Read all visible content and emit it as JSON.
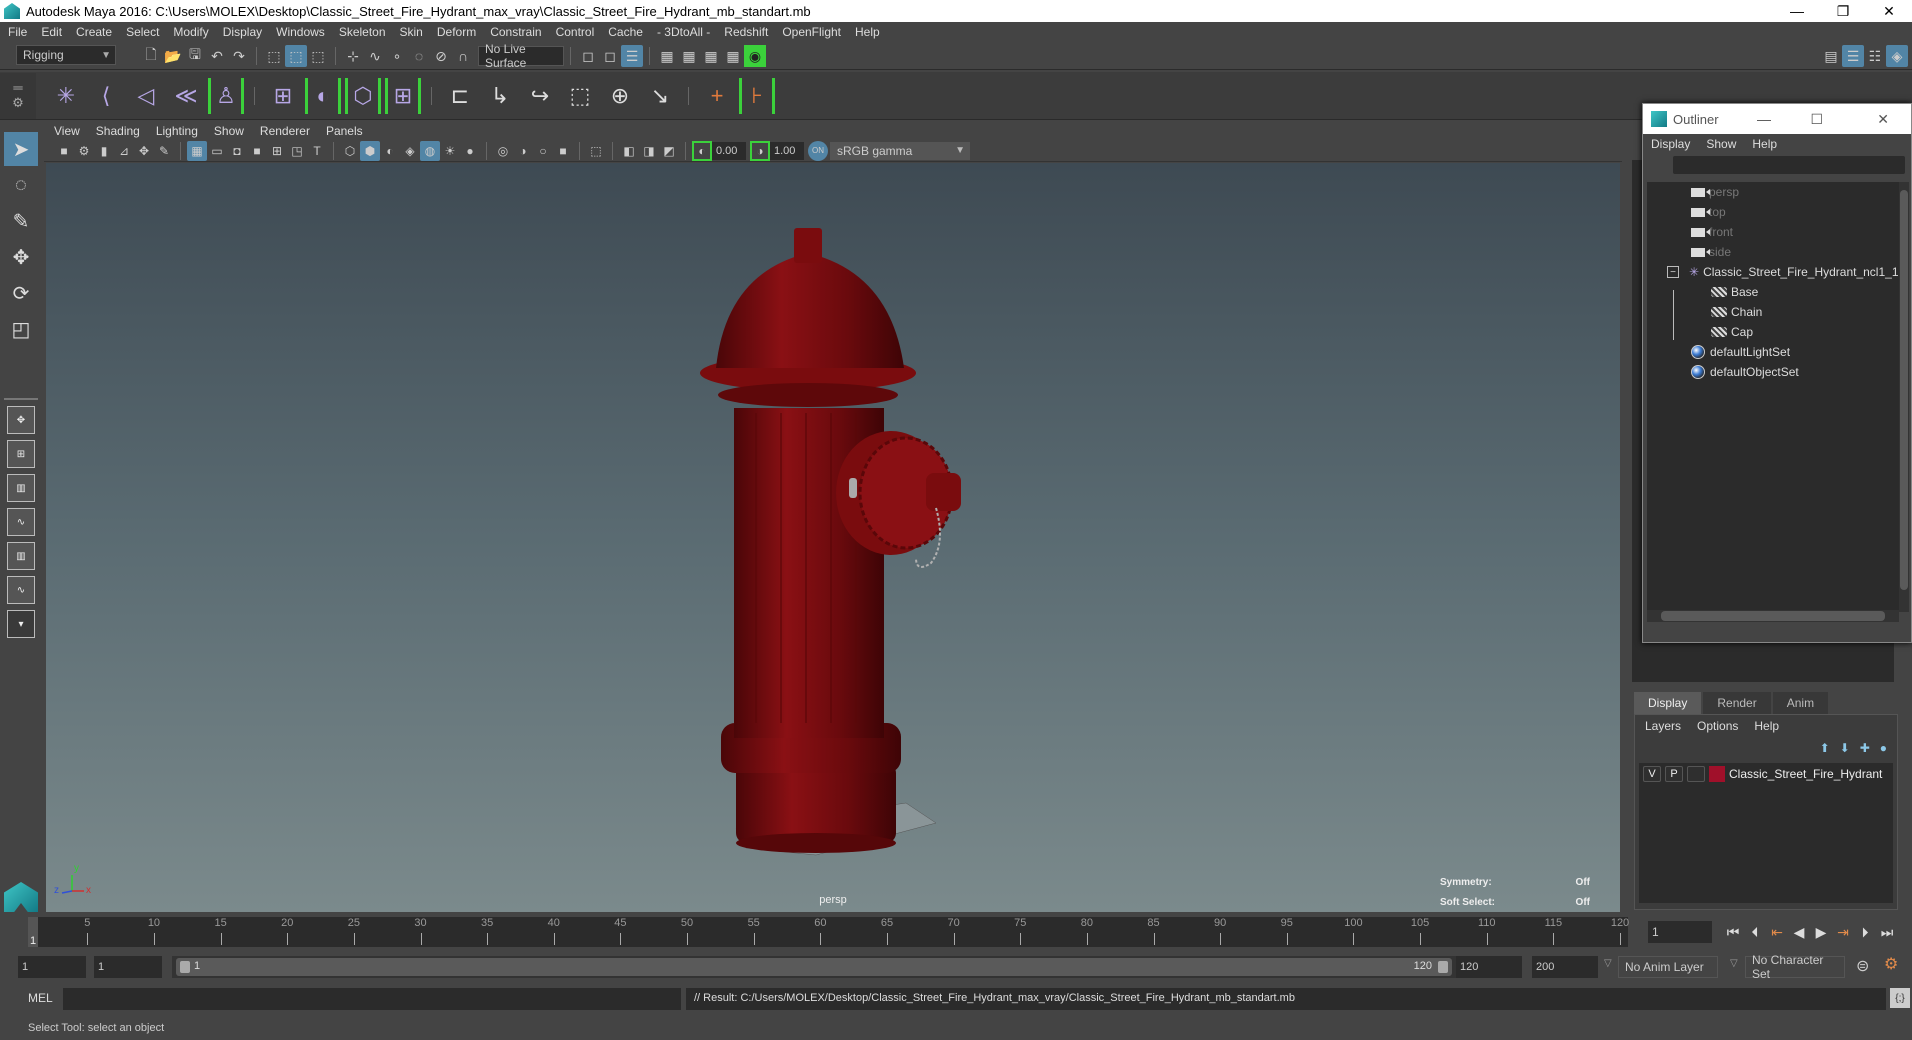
{
  "window": {
    "title": "Autodesk Maya 2016: C:\\Users\\MOLEX\\Desktop\\Classic_Street_Fire_Hydrant_max_vray\\Classic_Street_Fire_Hydrant_mb_standart.mb",
    "controls": {
      "minimize": "—",
      "restore": "❐",
      "close": "✕"
    }
  },
  "menubar": [
    "File",
    "Edit",
    "Create",
    "Select",
    "Modify",
    "Display",
    "Windows",
    "Skeleton",
    "Skin",
    "Deform",
    "Constrain",
    "Control",
    "Cache",
    "- 3DtoAll -",
    "Redshift",
    "OpenFlight",
    "Help"
  ],
  "statusline": {
    "menuset": "Rigging",
    "live_surface": "No Live Surface"
  },
  "shelf": {
    "tools": [
      "joint-tool",
      "ik-handle",
      "ik-spline",
      "skin-bind",
      "humanik",
      "paint-weights",
      "smooth-bind",
      "lattice",
      "cluster",
      "parent-constraint",
      "point-constraint",
      "orient-constraint",
      "scale-constraint",
      "aim-constraint",
      "pole-vector",
      "locator-orange",
      "locator-bracket-orange"
    ]
  },
  "viewport": {
    "menu": [
      "View",
      "Shading",
      "Lighting",
      "Show",
      "Renderer",
      "Panels"
    ],
    "exposure": "0.00",
    "gamma": "1.00",
    "colorspace": "sRGB gamma",
    "camera_label": "persp",
    "hud": [
      {
        "label": "Symmetry:",
        "value": "Off"
      },
      {
        "label": "Soft Select:",
        "value": "Off"
      }
    ],
    "axis": {
      "x": "x",
      "y": "y",
      "z": "z"
    },
    "object_color": "#7a0c0e"
  },
  "outliner": {
    "title": "Outliner",
    "menu": [
      "Display",
      "Show",
      "Help"
    ],
    "search_value": "",
    "items": [
      {
        "label": "persp",
        "icon": "camera-icon",
        "level": 1,
        "dim": true
      },
      {
        "label": "top",
        "icon": "camera-icon",
        "level": 1,
        "dim": true
      },
      {
        "label": "front",
        "icon": "camera-icon",
        "level": 1,
        "dim": true
      },
      {
        "label": "side",
        "icon": "camera-icon",
        "level": 1,
        "dim": true
      },
      {
        "label": "Classic_Street_Fire_Hydrant_ncl1_1",
        "icon": "group-icon",
        "level": 1,
        "expanded": true
      },
      {
        "label": "Base",
        "icon": "mesh-icon",
        "level": 2
      },
      {
        "label": "Chain",
        "icon": "mesh-icon",
        "level": 2
      },
      {
        "label": "Cap",
        "icon": "mesh-icon",
        "level": 2
      },
      {
        "label": "defaultLightSet",
        "icon": "set-icon",
        "level": 1
      },
      {
        "label": "defaultObjectSet",
        "icon": "set-icon",
        "level": 1
      }
    ]
  },
  "layers": {
    "tabs": [
      "Display",
      "Render",
      "Anim"
    ],
    "active_tab": "Display",
    "menu": [
      "Layers",
      "Options",
      "Help"
    ],
    "rows": [
      {
        "v": "V",
        "p": "P",
        "name": "Classic_Street_Fire_Hydrant",
        "color": "#a0102a"
      }
    ]
  },
  "timeline": {
    "start": 1,
    "end": 120,
    "current_frame": "1",
    "ticks": [
      5,
      10,
      15,
      20,
      25,
      30,
      35,
      40,
      45,
      50,
      55,
      60,
      65,
      70,
      75,
      80,
      85,
      90,
      95,
      100,
      105,
      110,
      115,
      120
    ],
    "current_frame_field": "1"
  },
  "range": {
    "start_field": "1",
    "playback_start_field": "1",
    "slider_start": "1",
    "slider_end": "120",
    "playback_end_field": "120",
    "end_field": "200",
    "anim_layer": "No Anim Layer",
    "character_set": "No Character Set"
  },
  "command": {
    "lang": "MEL",
    "input": "",
    "result": "// Result: C:/Users/MOLEX/Desktop/Classic_Street_Fire_Hydrant_max_vray/Classic_Street_Fire_Hydrant_mb_standart.mb"
  },
  "helpline": "Select Tool: select an object"
}
